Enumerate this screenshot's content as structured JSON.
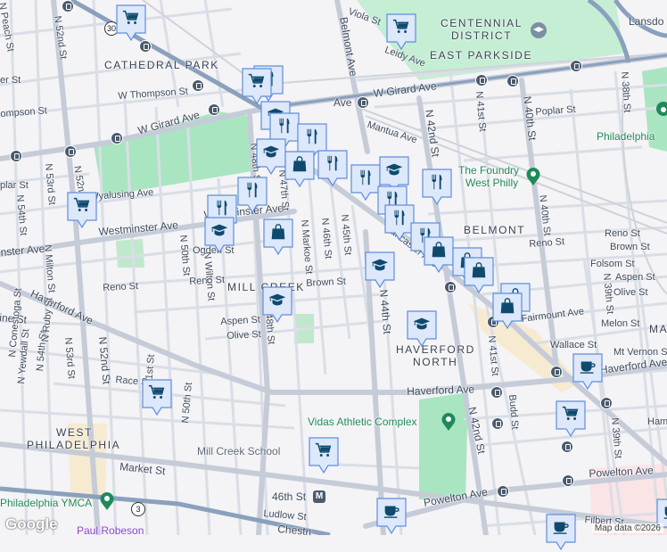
{
  "map": {
    "neighborhoods": {
      "cathedral_park": "CATHEDRAL PARK",
      "centennial_1": "CENTENNIAL",
      "centennial_2": "DISTRICT",
      "east_parkside": "EAST PARKSIDE",
      "belmont": "BELMONT",
      "mill_creek": "MILL CREEK",
      "haverford_north_1": "HAVERFORD",
      "haverford_north_2": "NORTH",
      "west_philadelphia_1": "WEST",
      "west_philadelphia_2": "PHILADELPHIA",
      "mantua_partial": "MA"
    },
    "streets": {
      "n_peach": "N Peach St",
      "n_52nd_top": "N 52nd St",
      "w_thompson": "W Thompson St",
      "thompson_left": "ompson St",
      "er_st": "er St",
      "w_girard_left": "W Girard Ave",
      "w_girard_right": "W Girard Ave",
      "girard_mid": "Ave",
      "n_52nd_mid": "N 52nd St",
      "n_53rd_top": "N 53rd St",
      "n_54th_top": "N 54th St",
      "poplar_left": "plar St",
      "wyalusing": "Wyalusing Ave",
      "westminster": "Westminster Ave",
      "westminster_left": "nster Ave",
      "westminster_right": "Westminster Ave",
      "n_50th_top": "N 50th St",
      "ogden": "Ogden St",
      "n_48th": "N 48th St",
      "n_47th": "N 47th St",
      "n_markoe": "N Markoe St",
      "n_46th": "N 46th St",
      "n_45th": "N 45th St",
      "belmont_ave": "Belmont Ave",
      "viola": "Viola St",
      "leidy": "Leidy Ave",
      "lansdowne": "Lansdo",
      "mantua": "Mantua Ave",
      "n_42nd_top": "N 42nd St",
      "n_41st_top": "N 41st St",
      "n_40th_top": "N 40th St",
      "poplar_right": "Poplar St",
      "n_38th": "N 38th St",
      "lancaster": "Lancaster Ave",
      "n_40th_mid": "N 40th St",
      "reno_right1": "Reno St",
      "reno_right2": "Reno St",
      "brown_right": "Brown St",
      "folsom": "Folsom St",
      "aspen_right": "Aspen St",
      "olive_right": "Olive St",
      "n_39th_top": "N 39th St",
      "fairmount": "Fairmount Ave",
      "melon": "Melon St",
      "wallace": "Wallace St",
      "mt_vernon": "Mt Vernon St",
      "haverford_right": "Haverford Ave",
      "haverford_mid": "Haverford Ave",
      "haverford_left": "Haverford Ave",
      "n_44th": "N 44th St",
      "n_41st_mid": "N 41st St",
      "budd": "Budd St",
      "n_42nd_bottom": "N 42nd St",
      "n_39th_bottom": "N 39th St",
      "hamilton": "Ham",
      "powelton_left": "Powelton Ave",
      "powelton_right": "Powelton Ave",
      "filbert": "Filbert St",
      "reno_left": "Reno St",
      "reno_mid": "Reno St",
      "brown_mid": "Brown St",
      "aspen_mid": "Aspen St",
      "olive_mid": "Olive St",
      "n_48th_bottom": "N 48th St",
      "pine_left": "ine St",
      "n_54th": "N 54th St",
      "n_ruby": "N Ruby St",
      "n_53rd": "N 53rd St",
      "n_52nd_bottom": "N 52nd St",
      "n_yewdall": "N Yewdall St",
      "n_conestoga": "N Conestoga St",
      "race": "Race St",
      "n_51st": "N 51st St",
      "n_50th_bottom": "N 50th St",
      "market": "Market St",
      "ludlow": "Ludlow St",
      "chestnut": "Chestn",
      "n_wilton": "N Wilton St",
      "n_milton": "N Milton St"
    },
    "places": {
      "foundry_1": "The Foundry",
      "foundry_2": "West Philly",
      "philadelphia_zoo": "Philadelphia",
      "vidas": "Vidas Athletic Complex",
      "mill_creek_school": "Mill Creek School",
      "ymca": "Philadelphia YMCA",
      "paul_robeson": "Paul Robeson",
      "station_46th": "46th St"
    },
    "route_shields": {
      "us30": "30",
      "pa3": "3"
    },
    "metro_icon": "M",
    "attribution": "Map data ©2026",
    "logo": "Google",
    "colors": {
      "background": "#f4f3f5",
      "road": "#d5dbe4",
      "major_road": "#c3cbd7",
      "highway": "#8aa0bd",
      "park": "#a9e5c1",
      "marker_fill": "#dde8fb",
      "marker_border": "#5f8fdc",
      "marker_icon": "#0e4a6e",
      "poi_green": "#1e8a5a"
    },
    "marker_types": [
      "cart-icon",
      "food-icon",
      "school-icon",
      "bag-icon",
      "coffee-icon"
    ]
  }
}
